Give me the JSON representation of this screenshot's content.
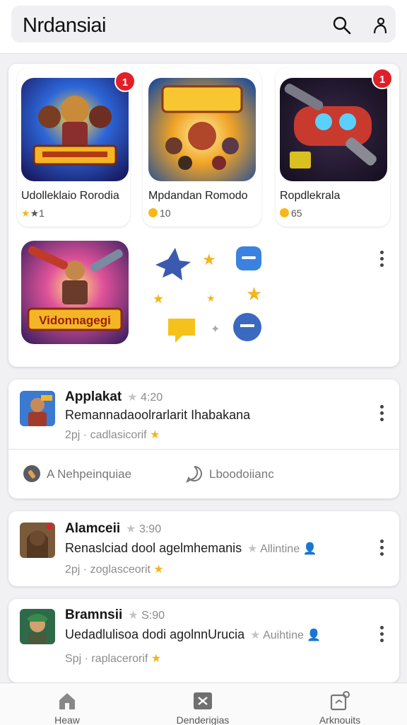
{
  "header": {
    "title": "Nrdansiai",
    "search_icon": "search-icon",
    "account_icon": "account-icon"
  },
  "featured": {
    "games": [
      {
        "name": "Udolleklaio Rorodia",
        "rating": "★1",
        "badge": "1"
      },
      {
        "name": "Mpdandan Romodo",
        "rating": "10"
      },
      {
        "name": "Ropdlekrala",
        "rating": "65",
        "badge": "1"
      }
    ],
    "fourth_game": {
      "art_text": "Vidonnagegi"
    }
  },
  "posts": [
    {
      "title": "Applakat",
      "time": "4:20",
      "text": "Remannadaoolrarlarit Ihabakana",
      "extra": "",
      "sub": "2pj · cadlasicorif",
      "actions": [
        "A Nehpeinquiae",
        "Lboodoiianc"
      ]
    },
    {
      "title": "Alamceii",
      "time": "3:90",
      "text": "Renaslciad dool agelmhemanis",
      "extra": "Allintine",
      "sub": "2pj · zoglasceorit"
    },
    {
      "title": "Bramnsii",
      "time": "S:90",
      "text": "Uedadlulisoa dodi agolnnUrucia",
      "extra": "Auihtine",
      "sub": "Spj · raplacerorif"
    }
  ],
  "bottom_nav": [
    {
      "label": "Heaw",
      "icon": "home-icon"
    },
    {
      "label": "Denderigias",
      "icon": "close-box-icon"
    },
    {
      "label": "Arknouits",
      "icon": "notification-box-icon"
    }
  ],
  "colors": {
    "badge": "#e02028",
    "star": "#f2b51b",
    "background": "#f1f1f3"
  }
}
